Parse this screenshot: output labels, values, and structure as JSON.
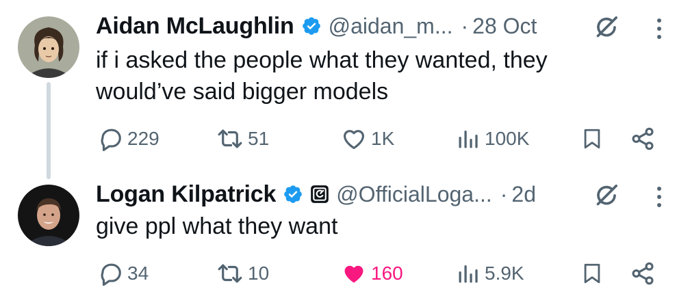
{
  "tweets": [
    {
      "author": {
        "name": "Aidan McLaughlin",
        "handle": "@aidan_m...",
        "verified": true
      },
      "timestamp": "28 Oct",
      "separator": "·",
      "text": "if i asked the people what they wanted, they would’ve said bigger models",
      "stats": {
        "replies": "229",
        "reposts": "51",
        "likes": "1K",
        "views": "100K"
      },
      "liked": false
    },
    {
      "author": {
        "name": "Logan Kilpatrick",
        "handle": "@OfficialLoga...",
        "verified": true,
        "affiliation_badge": true
      },
      "timestamp": "2d",
      "separator": "·",
      "text": "give ppl what they want",
      "stats": {
        "replies": "34",
        "reposts": "10",
        "likes": "160",
        "views": "5.9K"
      },
      "liked": true
    }
  ],
  "colors": {
    "text": "#0f1419",
    "secondary": "#536471",
    "verified_blue": "#1d9bf0",
    "like_pink": "#f91880",
    "thread_line": "#cfd9de"
  },
  "icons": [
    "reply-icon",
    "repost-icon",
    "like-icon",
    "views-icon",
    "bookmark-icon",
    "share-icon",
    "grok-icon",
    "more-icon",
    "verified-badge-icon",
    "affiliation-badge-icon"
  ]
}
